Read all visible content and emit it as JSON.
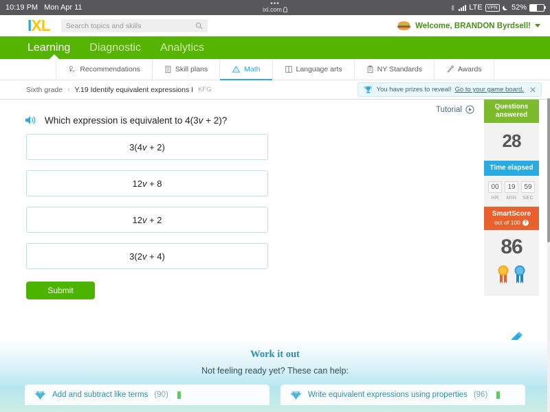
{
  "statusbar": {
    "time": "10:19 PM",
    "date": "Mon Apr 11",
    "url": "ixl.com",
    "dots": "•••",
    "network": "LTE",
    "vpn": "VPN",
    "battery": "52%"
  },
  "header": {
    "logo_i": "I",
    "logo_xl": "XL",
    "search_placeholder": "Search topics and skills",
    "welcome": "Welcome, BRANDON Byrdsell!"
  },
  "mainnav": [
    {
      "label": "Learning",
      "active": true
    },
    {
      "label": "Diagnostic",
      "active": false
    },
    {
      "label": "Analytics",
      "active": false
    }
  ],
  "subnav": [
    {
      "label": "Recommendations",
      "icon": "recommendations-icon",
      "active": false
    },
    {
      "label": "Skill plans",
      "icon": "skill-plans-icon",
      "active": false
    },
    {
      "label": "Math",
      "icon": "math-pyramid-icon",
      "active": true
    },
    {
      "label": "Language arts",
      "icon": "book-icon",
      "active": false
    },
    {
      "label": "NY Standards",
      "icon": "clipboard-icon",
      "active": false
    },
    {
      "label": "Awards",
      "icon": "awards-icon",
      "active": false
    }
  ],
  "breadcrumb": {
    "grade": "Sixth grade",
    "separator": "›",
    "skill": "Y.19 Identify equivalent expressions I",
    "code": "KFG"
  },
  "prize_banner": {
    "icon": "trophy-icon",
    "text": "You have prizes to reveal!",
    "link": "Go to your game board.",
    "close": "✕"
  },
  "question": {
    "speaker_icon": "speaker-icon",
    "prefix": "Which expression is equivalent to 4(3",
    "var": "v",
    "suffix": " + 2)?"
  },
  "choices": [
    {
      "pre": "3(4",
      "var": "v",
      "post": " + 2)"
    },
    {
      "pre": "12",
      "var": "v",
      "post": " + 8"
    },
    {
      "pre": "12",
      "var": "v",
      "post": " + 2"
    },
    {
      "pre": "3(2",
      "var": "v",
      "post": " + 4)"
    }
  ],
  "submit_label": "Submit",
  "tutorial": {
    "label": "Tutorial",
    "icon": "play-circle-icon"
  },
  "sidebar": {
    "questions_header": "Questions answered",
    "questions_value": "28",
    "time_header": "Time elapsed",
    "timer": [
      {
        "num": "00",
        "label": "HR"
      },
      {
        "num": "19",
        "label": "MIN"
      },
      {
        "num": "59",
        "label": "SEC"
      }
    ],
    "smartscore_header": "SmartScore",
    "smartscore_sub": "out of 100",
    "smartscore_help": "?",
    "smartscore_value": "86",
    "ribbons": [
      "gold-ribbon-icon",
      "blue-ribbon-icon"
    ]
  },
  "scratchpad_icon": "pencil-icon",
  "workout": {
    "title": "Work it out",
    "subtitle": "Not feeling ready yet? These can help:",
    "cards": [
      {
        "icon": "diamond-icon",
        "label": "Add and subtract like terms",
        "count": "(90)"
      },
      {
        "icon": "diamond-icon",
        "label": "Write equivalent expressions using properties",
        "count": "(96)"
      }
    ]
  },
  "colors": {
    "green": "#55b400",
    "blue": "#29abe2",
    "orange": "#e8602c",
    "yellow": "#fdc800"
  }
}
